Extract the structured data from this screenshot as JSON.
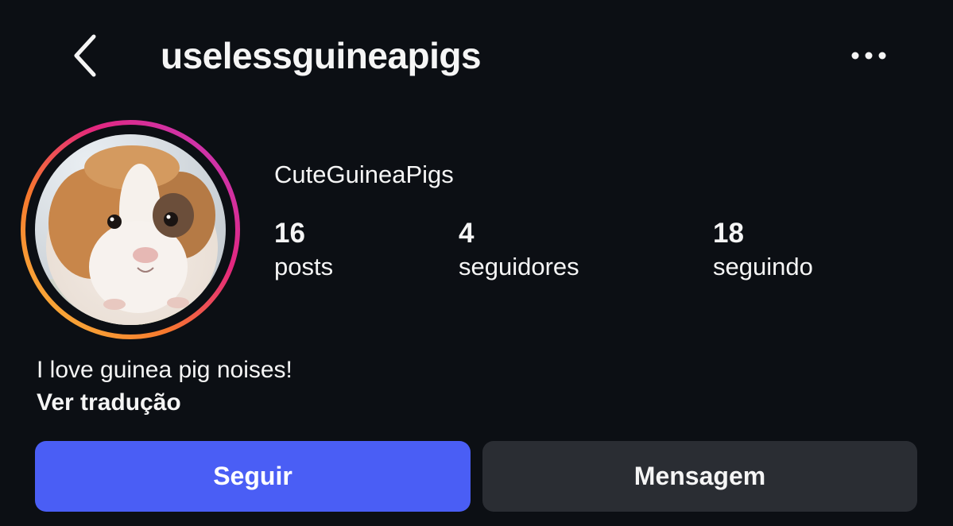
{
  "header": {
    "username": "uselessguineapigs",
    "back_icon": "chevron-left-icon",
    "more_icon": "more-horizontal-icon"
  },
  "profile": {
    "avatar_description_icon": "guinea-pig-avatar",
    "story_ring_colors": [
      "#f9b233",
      "#f0522d",
      "#d6249f",
      "#c13584"
    ],
    "display_name": "CuteGuineaPigs",
    "stats": {
      "posts_count": "16",
      "posts_label": "posts",
      "followers_count": "4",
      "followers_label": "seguidores",
      "following_count": "18",
      "following_label": "seguindo"
    },
    "bio": "I love guinea pig noises!",
    "translate_label": "Ver tradução"
  },
  "actions": {
    "follow_label": "Seguir",
    "message_label": "Mensagem",
    "follow_color": "#4a5ef5",
    "message_color": "#2a2d33"
  }
}
